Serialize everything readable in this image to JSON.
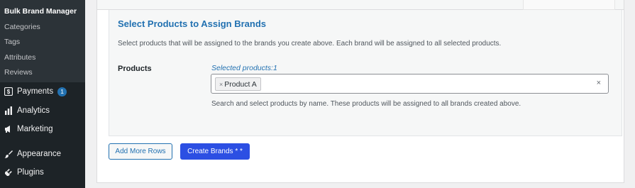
{
  "sidebar": {
    "submenu": [
      {
        "label": "Bulk Brand Manager",
        "active": true
      },
      {
        "label": "Categories",
        "active": false
      },
      {
        "label": "Tags",
        "active": false
      },
      {
        "label": "Attributes",
        "active": false
      },
      {
        "label": "Reviews",
        "active": false
      }
    ],
    "menu": [
      {
        "label": "Payments",
        "icon": "payments-icon",
        "badge": "1"
      },
      {
        "label": "Analytics",
        "icon": "bar-chart-icon"
      },
      {
        "label": "Marketing",
        "icon": "megaphone-icon"
      },
      {
        "label": "Appearance",
        "icon": "paintbrush-icon"
      },
      {
        "label": "Plugins",
        "icon": "plugin-icon"
      }
    ]
  },
  "section": {
    "title": "Select Products to Assign Brands",
    "description": "Select products that will be assigned to the brands you create above. Each brand will be assigned to all selected products.",
    "products_label": "Products",
    "selected_count": "Selected products:1",
    "selected_items": [
      "Product A"
    ],
    "chip_remove": "×",
    "clear_symbol": "×",
    "help_text": "Search and select products by name. These products will be assigned to all brands created above."
  },
  "buttons": {
    "add_more_rows": "Add More Rows",
    "create_brands": "Create Brands * *"
  },
  "colors": {
    "accent": "#2271b1",
    "primary_button": "#2c4fe3",
    "sidebar_bg": "#1d2327"
  }
}
